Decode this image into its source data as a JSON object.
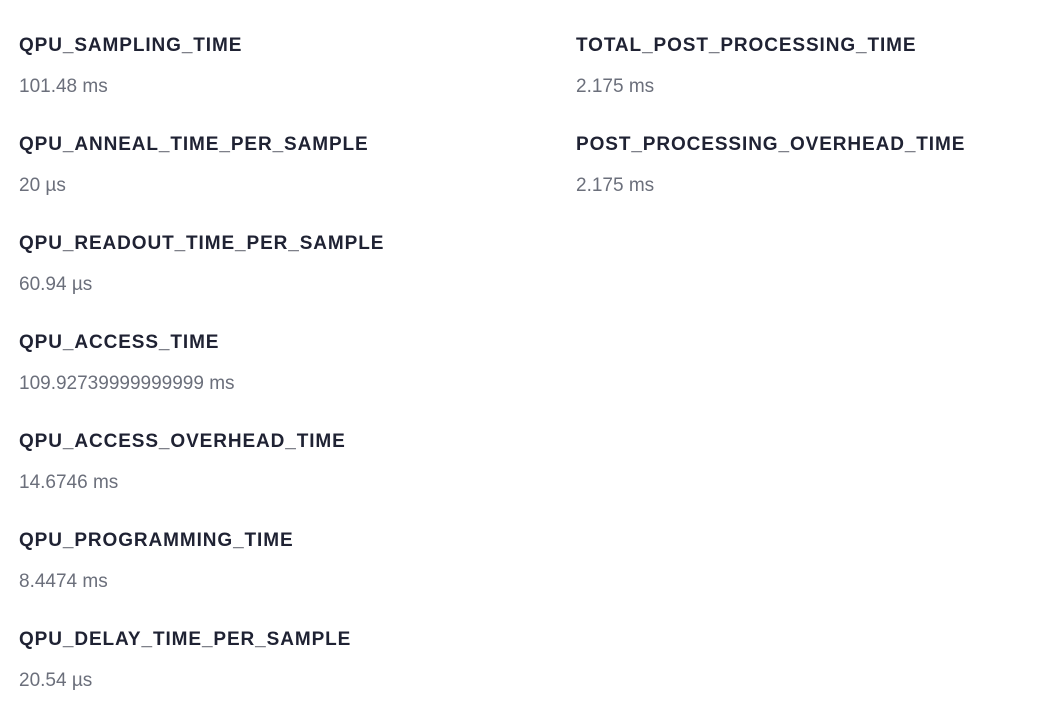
{
  "timing": {
    "left": [
      {
        "label": "QPU_SAMPLING_TIME",
        "value": "101.48 ms"
      },
      {
        "label": "QPU_ANNEAL_TIME_PER_SAMPLE",
        "value": "20 µs"
      },
      {
        "label": "QPU_READOUT_TIME_PER_SAMPLE",
        "value": "60.94 µs"
      },
      {
        "label": "QPU_ACCESS_TIME",
        "value": "109.92739999999999 ms"
      },
      {
        "label": "QPU_ACCESS_OVERHEAD_TIME",
        "value": "14.6746 ms"
      },
      {
        "label": "QPU_PROGRAMMING_TIME",
        "value": "8.4474 ms"
      },
      {
        "label": "QPU_DELAY_TIME_PER_SAMPLE",
        "value": "20.54 µs"
      }
    ],
    "right": [
      {
        "label": "TOTAL_POST_PROCESSING_TIME",
        "value": "2.175 ms"
      },
      {
        "label": "POST_PROCESSING_OVERHEAD_TIME",
        "value": "2.175 ms"
      }
    ]
  }
}
